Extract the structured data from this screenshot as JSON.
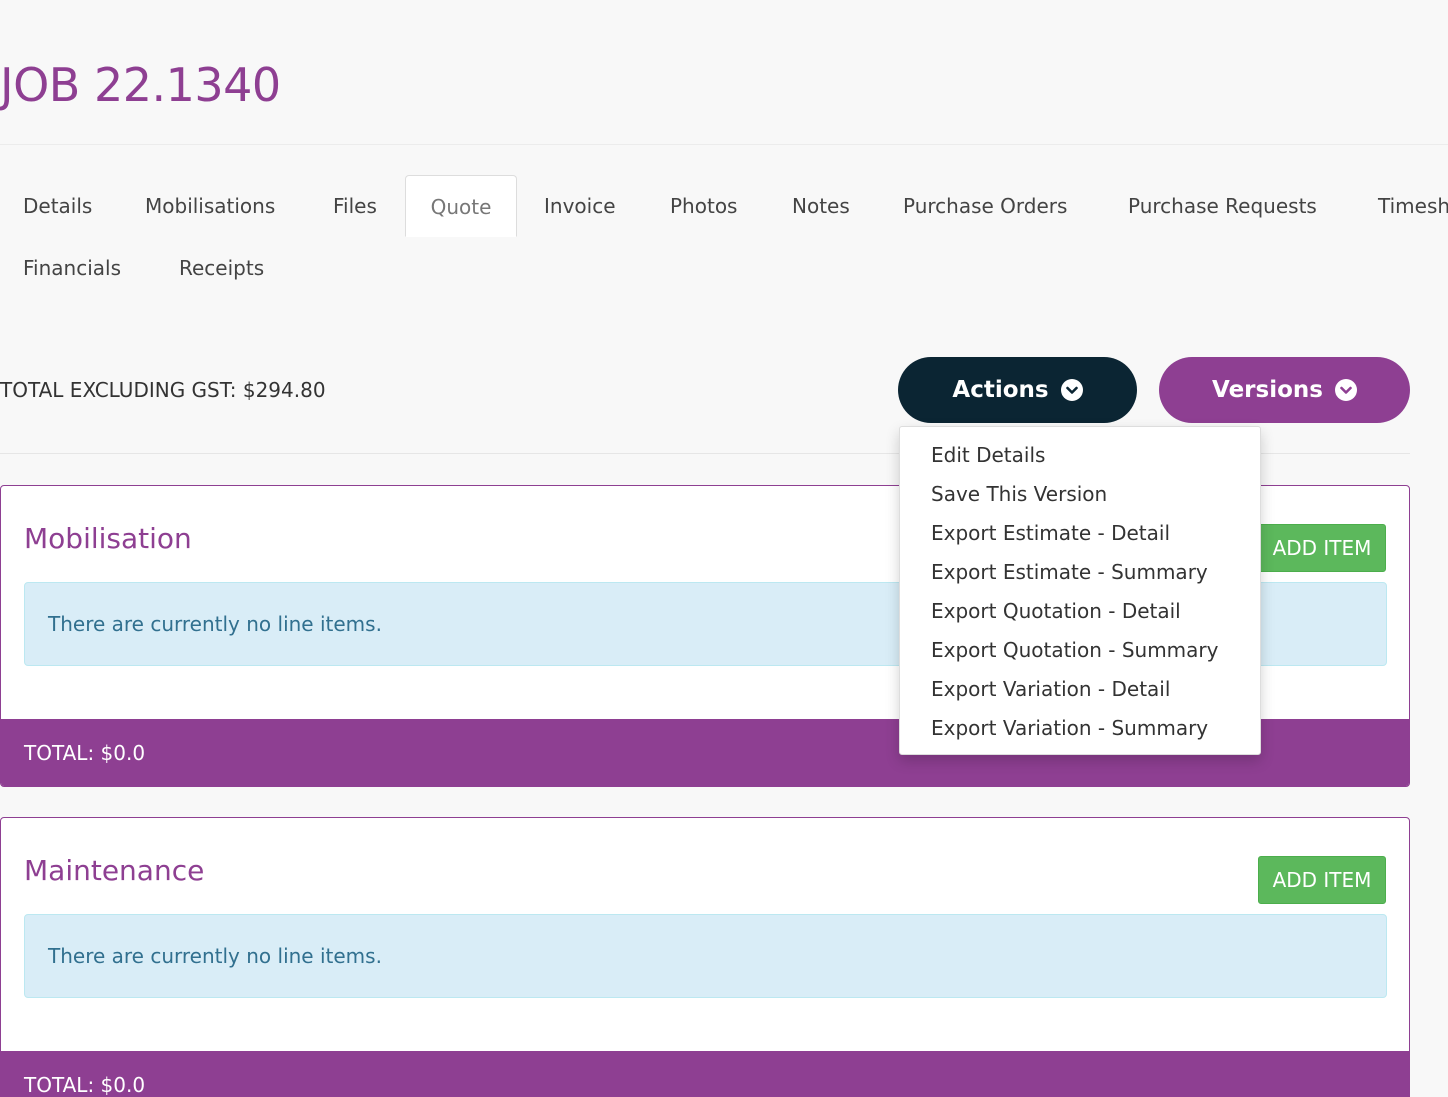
{
  "page": {
    "title": "JOB 22.1340"
  },
  "tabs": [
    {
      "label": "Details"
    },
    {
      "label": "Mobilisations"
    },
    {
      "label": "Files"
    },
    {
      "label": "Quote",
      "active": true
    },
    {
      "label": "Invoice"
    },
    {
      "label": "Photos"
    },
    {
      "label": "Notes"
    },
    {
      "label": "Purchase Orders"
    },
    {
      "label": "Purchase Requests"
    },
    {
      "label": "Timesh"
    },
    {
      "label": "Financials"
    },
    {
      "label": "Receipts"
    }
  ],
  "summary": {
    "total_excl_gst": "TOTAL EXCLUDING GST: $294.80"
  },
  "actions": {
    "label": "Actions",
    "icon": "chevron-down-circle-icon",
    "menu": [
      "Edit Details",
      "Save This Version",
      "Export Estimate - Detail",
      "Export Estimate - Summary",
      "Export Quotation - Detail",
      "Export Quotation - Summary",
      "Export Variation - Detail",
      "Export Variation - Summary"
    ]
  },
  "versions": {
    "label": "Versions",
    "icon": "chevron-down-circle-icon"
  },
  "sections": [
    {
      "title": "Mobilisation",
      "add_label": "ADD ITEM",
      "empty_text": "There are currently no line items.",
      "total": "TOTAL: $0.0"
    },
    {
      "title": "Maintenance",
      "add_label": "ADD ITEM",
      "empty_text": "There are currently no line items.",
      "total": "TOTAL: $0.0"
    }
  ],
  "colors": {
    "brand_purple": "#8e3f92",
    "actions_dark": "#0b2533",
    "add_green": "#5cb85c",
    "alert_blue": "#d9edf7"
  }
}
